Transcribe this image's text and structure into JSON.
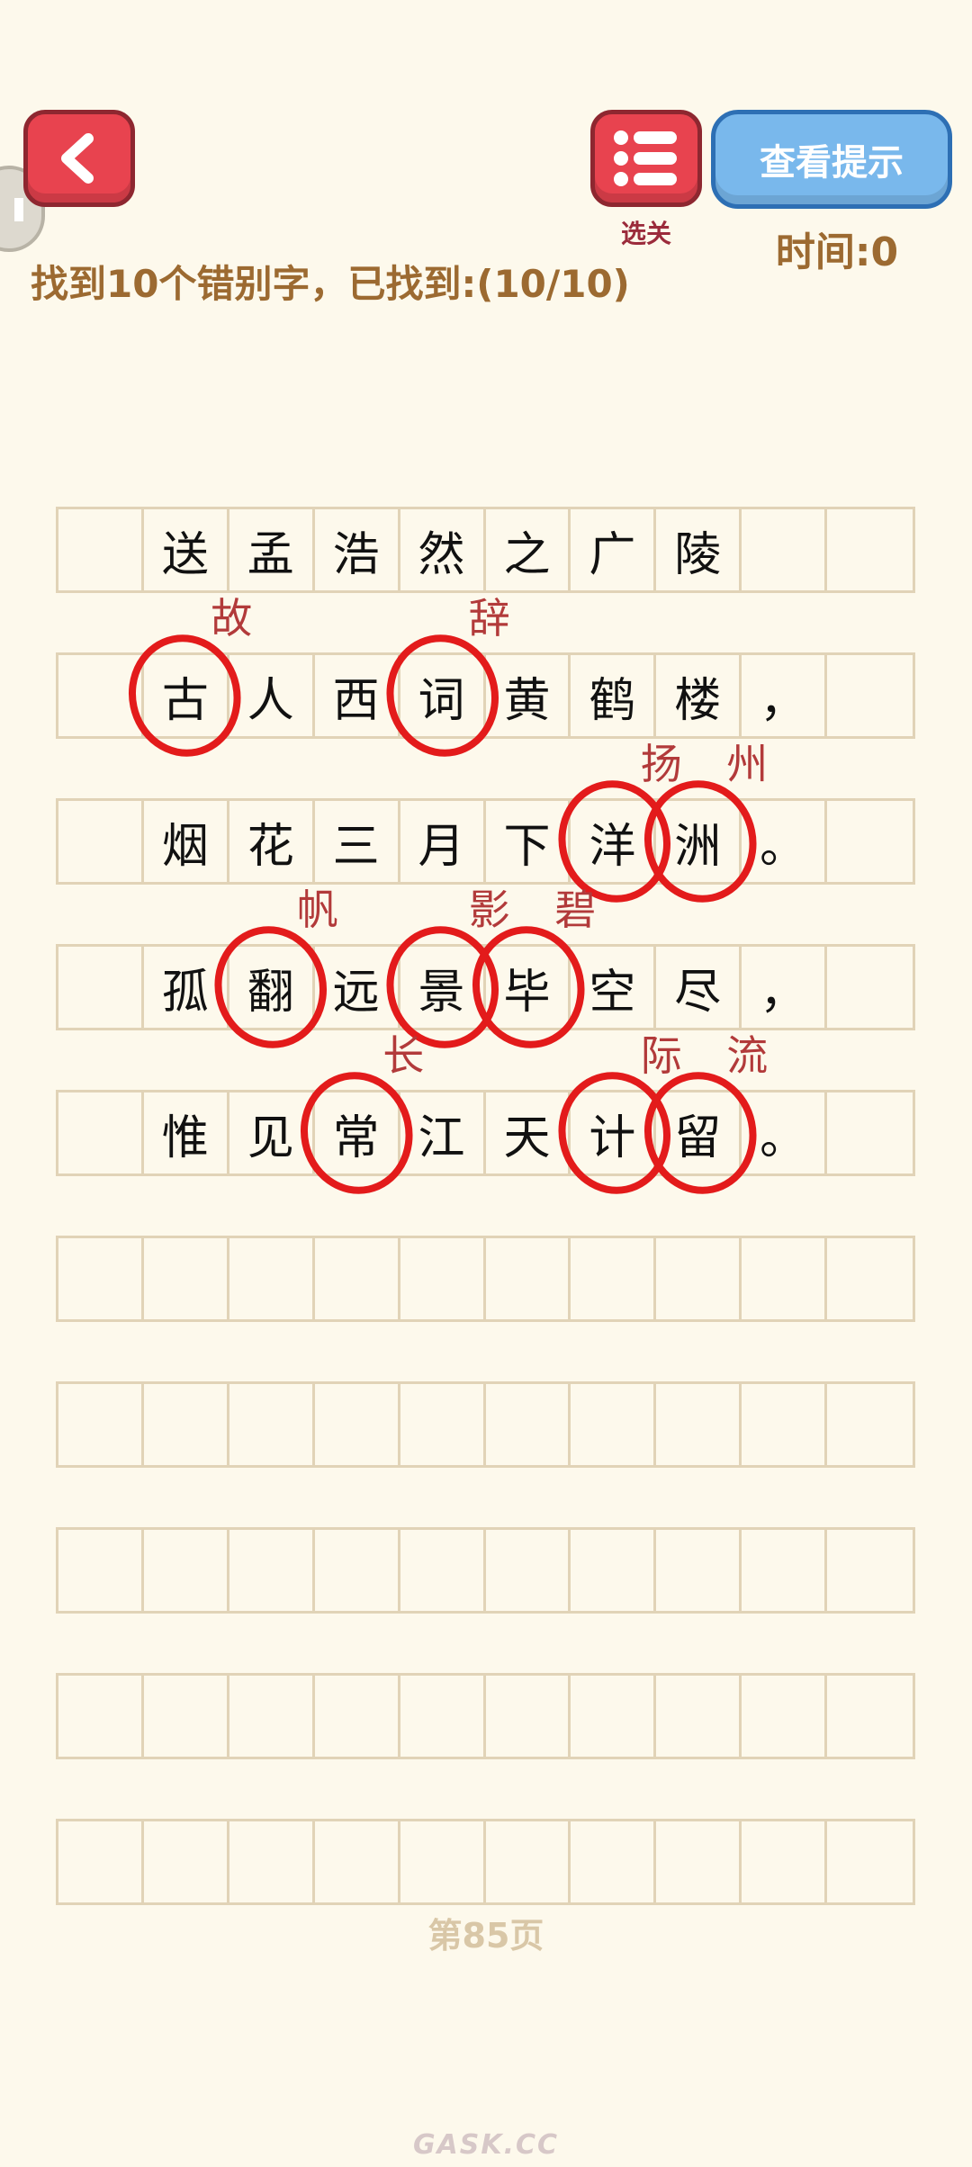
{
  "header": {
    "menu_label": "选关",
    "hint_label": "查看提示",
    "timer_text": "时间:0",
    "task_text": "找到10个错别字，已找到:(10/10)"
  },
  "poem": [
    [
      "",
      "送",
      "孟",
      "浩",
      "然",
      "之",
      "广",
      "陵",
      "",
      ""
    ],
    [
      "",
      "古",
      "人",
      "西",
      "词",
      "黄",
      "鹤",
      "楼",
      "，",
      ""
    ],
    [
      "",
      "烟",
      "花",
      "三",
      "月",
      "下",
      "洋",
      "洲",
      "。",
      ""
    ],
    [
      "",
      "孤",
      "翻",
      "远",
      "景",
      "毕",
      "空",
      "尽",
      "，",
      ""
    ],
    [
      "",
      "惟",
      "见",
      "常",
      "江",
      "天",
      "计",
      "留",
      "。",
      ""
    ],
    [
      "",
      "",
      "",
      "",
      "",
      "",
      "",
      "",
      "",
      ""
    ],
    [
      "",
      "",
      "",
      "",
      "",
      "",
      "",
      "",
      "",
      ""
    ],
    [
      "",
      "",
      "",
      "",
      "",
      "",
      "",
      "",
      "",
      ""
    ],
    [
      "",
      "",
      "",
      "",
      "",
      "",
      "",
      "",
      "",
      ""
    ],
    [
      "",
      "",
      "",
      "",
      "",
      "",
      "",
      "",
      "",
      ""
    ]
  ],
  "corrections": [
    {
      "row": 1,
      "col": 1,
      "text": "故"
    },
    {
      "row": 1,
      "col": 4,
      "text": "辞"
    },
    {
      "row": 2,
      "col": 6,
      "text": "扬"
    },
    {
      "row": 2,
      "col": 7,
      "text": "州"
    },
    {
      "row": 3,
      "col": 2,
      "text": "帆"
    },
    {
      "row": 3,
      "col": 4,
      "text": "影"
    },
    {
      "row": 3,
      "col": 5,
      "text": "碧"
    },
    {
      "row": 4,
      "col": 3,
      "text": "长"
    },
    {
      "row": 4,
      "col": 6,
      "text": "际"
    },
    {
      "row": 4,
      "col": 7,
      "text": "流"
    }
  ],
  "page_label": "第85页",
  "watermark": "GASK.CC",
  "colors": {
    "background": "#fdf9ec",
    "red_button": "#e8434f",
    "blue_button": "#79b8ec",
    "brown_text": "#9c6a31",
    "grid_line": "#e1d3b7",
    "mark_red": "#e31b1b",
    "correction_text": "#b23a3a"
  }
}
